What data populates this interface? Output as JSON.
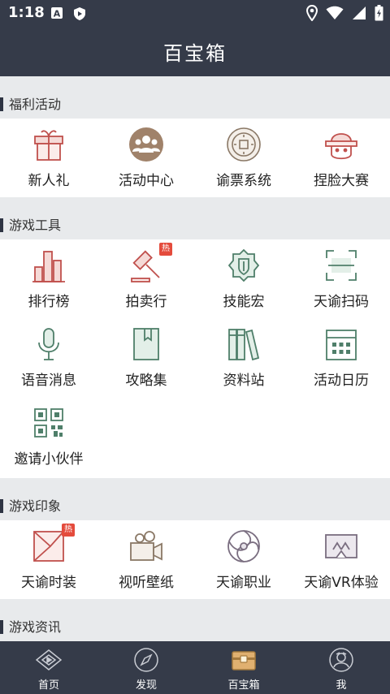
{
  "status_bar": {
    "time": "1:18"
  },
  "title": "百宝箱",
  "sections": {
    "welfare": {
      "title": "福利活动",
      "items": [
        {
          "label": "新人礼",
          "icon": "gift-icon"
        },
        {
          "label": "活动中心",
          "icon": "people-circle-icon"
        },
        {
          "label": "谕票系统",
          "icon": "coin-icon"
        },
        {
          "label": "捏脸大赛",
          "icon": "face-icon"
        }
      ]
    },
    "tools": {
      "title": "游戏工具",
      "items": [
        {
          "label": "排行榜",
          "icon": "bar-chart-icon"
        },
        {
          "label": "拍卖行",
          "icon": "gavel-icon",
          "badge": "热"
        },
        {
          "label": "技能宏",
          "icon": "shield-emblem-icon"
        },
        {
          "label": "天谕扫码",
          "icon": "scan-icon"
        },
        {
          "label": "语音消息",
          "icon": "microphone-icon"
        },
        {
          "label": "攻略集",
          "icon": "book-icon"
        },
        {
          "label": "资料站",
          "icon": "books-icon"
        },
        {
          "label": "活动日历",
          "icon": "calendar-icon"
        },
        {
          "label": "邀请小伙伴",
          "icon": "qr-code-icon"
        }
      ]
    },
    "impression": {
      "title": "游戏印象",
      "items": [
        {
          "label": "天谕时装",
          "icon": "fashion-icon",
          "badge": "热"
        },
        {
          "label": "视听壁纸",
          "icon": "video-camera-icon"
        },
        {
          "label": "天谕职业",
          "icon": "swirl-icon"
        },
        {
          "label": "天谕VR体验",
          "icon": "vr-headset-icon"
        }
      ]
    },
    "news": {
      "title": "游戏资讯"
    }
  },
  "tabs": [
    {
      "label": "首页",
      "icon": "home-icon",
      "active": false
    },
    {
      "label": "发现",
      "icon": "compass-icon",
      "active": false
    },
    {
      "label": "百宝箱",
      "icon": "treasure-chest-icon",
      "active": true
    },
    {
      "label": "我",
      "icon": "profile-icon",
      "active": false
    }
  ],
  "colors": {
    "header_bg": "#353b49",
    "accent_red": "#c0504d",
    "accent_green": "#4f7f6a",
    "active_tab": "#e0b070"
  }
}
